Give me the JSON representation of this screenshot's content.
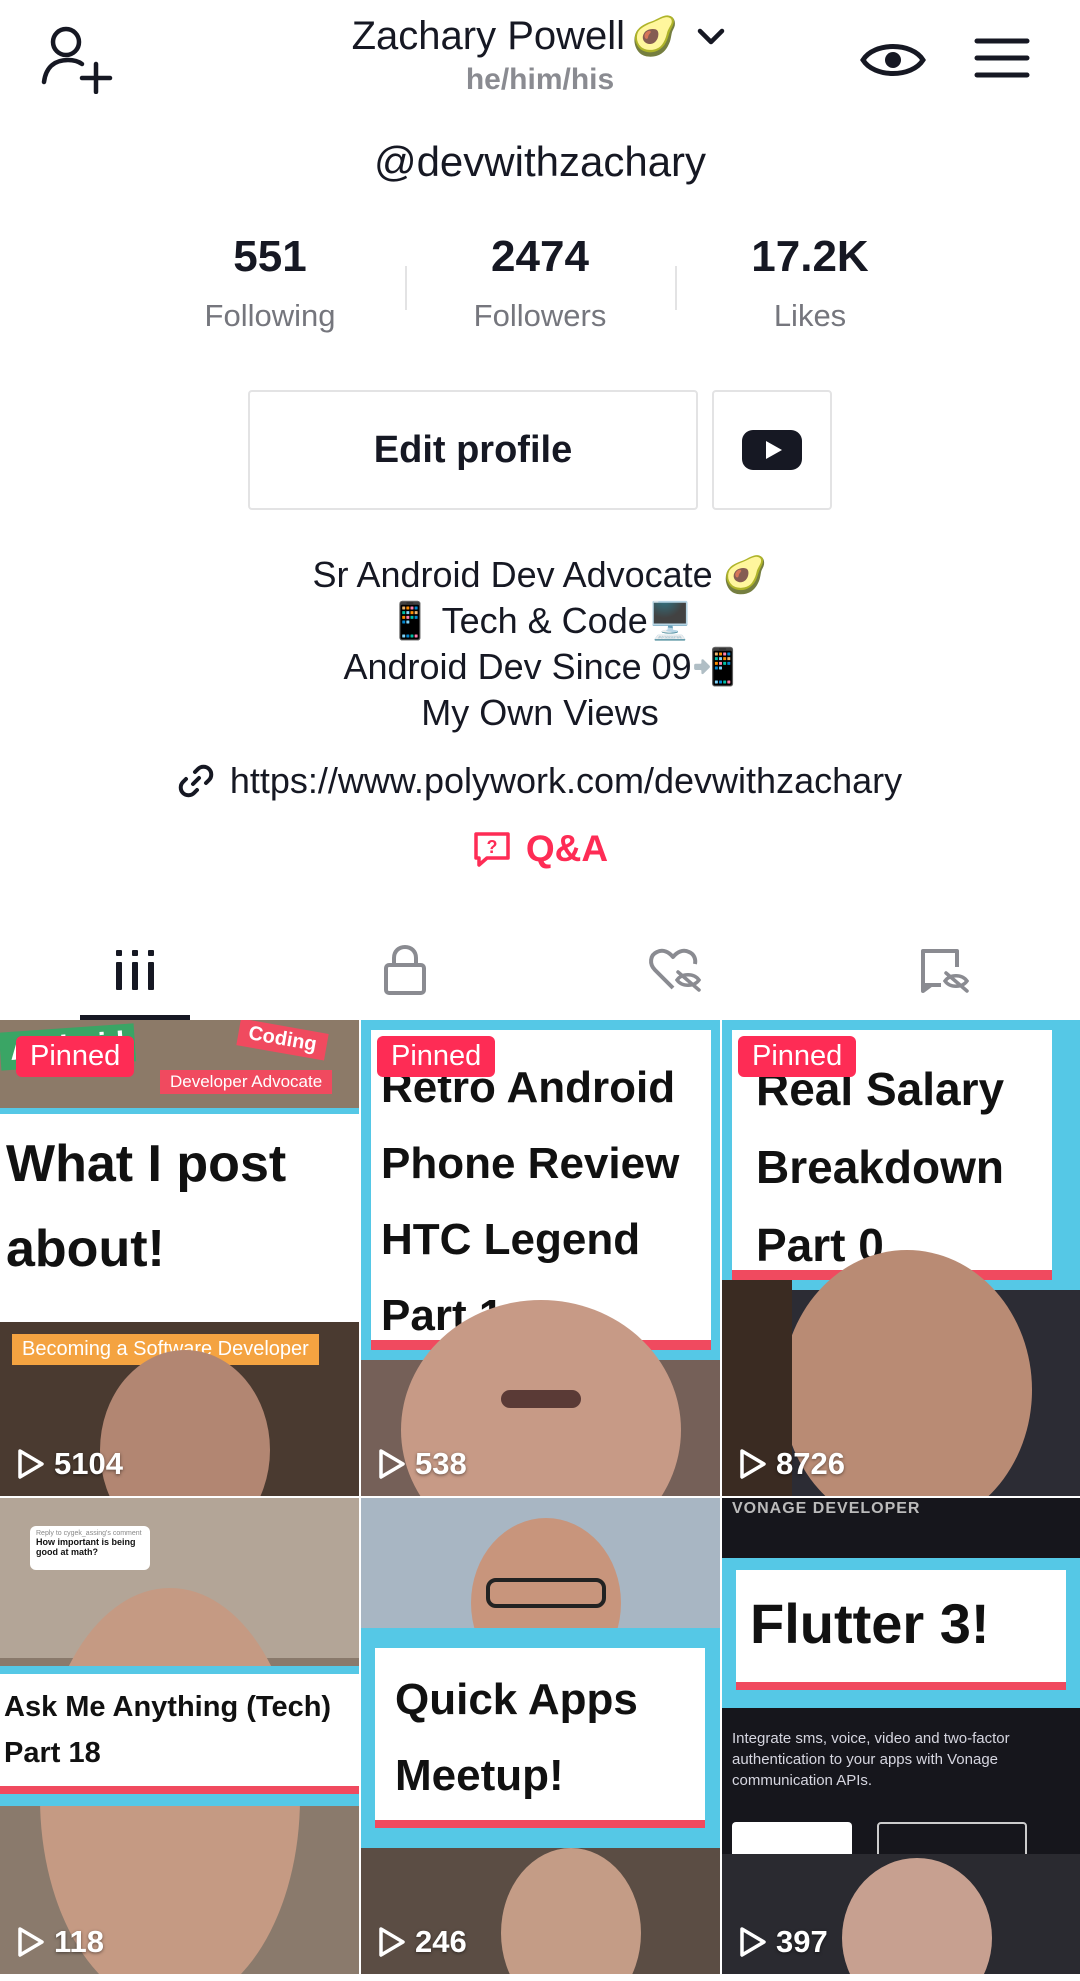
{
  "header": {
    "display_name": "Zachary Powell",
    "name_emoji": "🥑",
    "pronouns": "he/him/his",
    "icons": [
      "add-user-icon",
      "chevron-down-icon",
      "eye-icon",
      "menu-icon"
    ]
  },
  "profile": {
    "handle": "@devwithzachary"
  },
  "stats": [
    {
      "value": "551",
      "label": "Following"
    },
    {
      "value": "2474",
      "label": "Followers"
    },
    {
      "value": "17.2K",
      "label": "Likes"
    }
  ],
  "actions": {
    "edit_profile": "Edit profile",
    "youtube_icon": "youtube-icon"
  },
  "bio": {
    "lines": [
      "Sr Android Dev Advocate 🥑",
      "📱 Tech & Code🖥️",
      "Android Dev Since 09📲",
      "My Own Views"
    ],
    "link": "https://www.polywork.com/devwithzachary",
    "qa_label": "Q&A"
  },
  "tabs": [
    {
      "name": "videos",
      "icon": "grid-icon",
      "active": true
    },
    {
      "name": "private",
      "icon": "lock-icon",
      "active": false
    },
    {
      "name": "liked",
      "icon": "hidden-heart-icon",
      "active": false
    },
    {
      "name": "favorites",
      "icon": "hidden-bookmark-icon",
      "active": false
    }
  ],
  "videos": [
    {
      "pinned": "Pinned",
      "views": "5104",
      "overlay": [
        "What I post",
        "about!"
      ],
      "tag_top": "Developer Advocate",
      "tag_top2": "Android",
      "tag_top3": "Coding",
      "tag_bottom": "Becoming a Software Developer"
    },
    {
      "pinned": "Pinned",
      "views": "538",
      "overlay": [
        "Retro Android",
        "Phone Review",
        "HTC Legend",
        "Part 1"
      ]
    },
    {
      "pinned": "Pinned",
      "views": "8726",
      "overlay": [
        "Real Salary",
        "Breakdown",
        "Part 0"
      ]
    },
    {
      "pinned": "",
      "views": "118",
      "overlay": [
        "Ask Me Anything (Tech)",
        "Part 18"
      ],
      "comment_reply": "Reply to cygek_assing's comment",
      "comment_text": "How important is being good at math?"
    },
    {
      "pinned": "",
      "views": "246",
      "overlay": [
        "Quick Apps",
        "Meetup!"
      ]
    },
    {
      "pinned": "",
      "views": "397",
      "overlay": [
        "Flutter 3!"
      ],
      "brand": "VONAGE DEVELOPER",
      "caption": "Integrate sms, voice, video and two-factor authentication to your apps with Vonage communication APIs."
    }
  ],
  "colors": {
    "accent": "#fe2c55",
    "text_primary": "#161823",
    "text_secondary": "#75767d",
    "card_cyan": "#55c8e6",
    "card_red": "#f04a5f"
  }
}
